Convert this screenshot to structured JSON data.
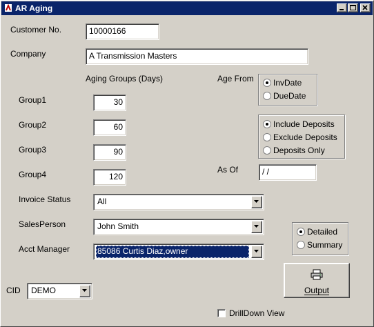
{
  "window": {
    "title": "AR Aging"
  },
  "customer": {
    "label": "Customer No.",
    "value": "10000166"
  },
  "company": {
    "label": "Company",
    "value": "A Transmission Masters"
  },
  "aging_groups": {
    "heading": "Aging Groups (Days)",
    "groups": [
      {
        "label": "Group1",
        "value": "30"
      },
      {
        "label": "Group2",
        "value": "60"
      },
      {
        "label": "Group3",
        "value": "90"
      },
      {
        "label": "Group4",
        "value": "120"
      }
    ]
  },
  "age_from": {
    "label": "Age From",
    "options": [
      {
        "label": "InvDate",
        "selected": true
      },
      {
        "label": "DueDate",
        "selected": false
      }
    ]
  },
  "deposits": {
    "options": [
      {
        "label": "Include Deposits",
        "selected": true
      },
      {
        "label": "Exclude Deposits",
        "selected": false
      },
      {
        "label": "Deposits Only",
        "selected": false
      }
    ]
  },
  "as_of": {
    "label": "As Of",
    "value": " / /"
  },
  "invoice_status": {
    "label": "Invoice Status",
    "value": "All"
  },
  "salesperson": {
    "label": "SalesPerson",
    "value": "John Smith"
  },
  "acct_manager": {
    "label": "Acct Manager",
    "value": "85086 Curtis Diaz,owner"
  },
  "report_type": {
    "options": [
      {
        "label": "Detailed",
        "selected": true
      },
      {
        "label": "Summary",
        "selected": false
      }
    ]
  },
  "output_button": {
    "label": "Output",
    "icon": "printer-icon"
  },
  "cid": {
    "label": "CID",
    "value": "DEMO"
  },
  "drilldown": {
    "label": "DrillDown View",
    "checked": false
  },
  "colors": {
    "titlebar": "#0a246a",
    "face": "#d4d0c8",
    "selection": "#0a246a"
  }
}
